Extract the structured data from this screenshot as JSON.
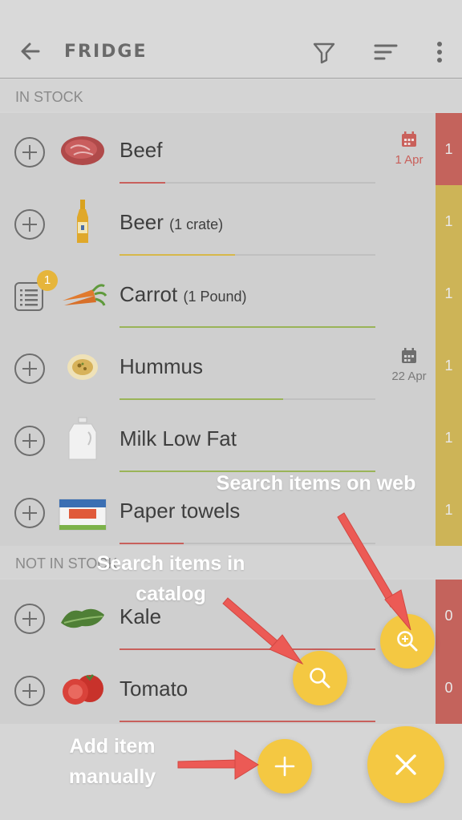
{
  "appbar": {
    "title": "FRIDGE",
    "back_icon": "arrow-left-icon",
    "filter_icon": "filter-icon",
    "sort_icon": "sort-icon",
    "more_icon": "more-vertical-icon"
  },
  "sections": {
    "in_stock": "IN STOCK",
    "not_in_stock": "NOT IN STOCK"
  },
  "items": [
    {
      "name": "Beef",
      "qty": "",
      "date": "1 Apr",
      "count": "1",
      "level": 0.18,
      "bar_color": "#c8605c",
      "count_color": "#c4635c",
      "date_color": "#c9605b",
      "action": "add",
      "thumb": "beef"
    },
    {
      "name": "Beer",
      "qty": "(1 crate)",
      "date": "",
      "count": "1",
      "level": 0.45,
      "bar_color": "#d6b84a",
      "count_color": "#cdb457",
      "date_color": "",
      "action": "add",
      "thumb": "beer"
    },
    {
      "name": "Carrot",
      "qty": "(1 Pound)",
      "date": "",
      "count": "1",
      "level": 1.0,
      "bar_color": "#9ab458",
      "count_color": "#cdb457",
      "date_color": "",
      "action": "list",
      "badge": "1",
      "thumb": "carrot"
    },
    {
      "name": "Hummus",
      "qty": "",
      "date": "22 Apr",
      "count": "1",
      "level": 0.64,
      "bar_color": "#9ab458",
      "count_color": "#cdb457",
      "date_color": "#7a7a7a",
      "action": "add",
      "thumb": "hummus"
    },
    {
      "name": "Milk Low Fat",
      "qty": "",
      "date": "",
      "count": "1",
      "level": 1.0,
      "bar_color": "#9ab458",
      "count_color": "#cdb457",
      "date_color": "",
      "action": "add",
      "thumb": "milk"
    },
    {
      "name": "Paper towels",
      "qty": "",
      "date": "",
      "count": "1",
      "level": 0.25,
      "bar_color": "#c8605c",
      "count_color": "#cdb457",
      "date_color": "",
      "action": "add",
      "thumb": "paper-towels"
    }
  ],
  "not_in_stock_items": [
    {
      "name": "Kale",
      "count": "0",
      "level": 1.0,
      "bar_color": "#c8605c",
      "count_color": "#c4635c",
      "thumb": "kale"
    },
    {
      "name": "Tomato",
      "count": "0",
      "level": 1.0,
      "bar_color": "#c8605c",
      "count_color": "#c4635c",
      "thumb": "tomato"
    }
  ],
  "annotations": {
    "web": "Search items on web",
    "catalog_line1": "Search items in",
    "catalog_line2": "catalog",
    "manual_line1": "Add item",
    "manual_line2": "manually"
  },
  "fabs": {
    "web_icon": "zoom-search-icon",
    "catalog_icon": "search-icon",
    "add_icon": "plus-icon",
    "close_icon": "close-icon",
    "color": "#f4c842"
  }
}
